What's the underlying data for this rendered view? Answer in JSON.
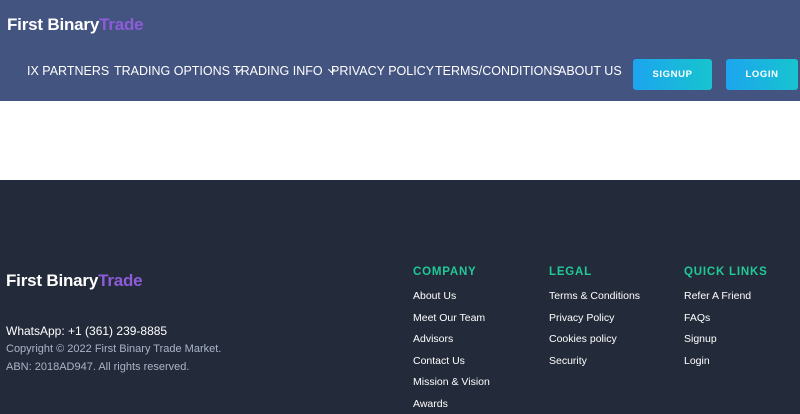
{
  "brand": {
    "part1": "First Binary",
    "part2": "Trade"
  },
  "nav": {
    "items": [
      {
        "label": "IX PARTNERS",
        "dropdown": false
      },
      {
        "label": "TRADING OPTIONS",
        "dropdown": true
      },
      {
        "label": "TRADING INFO",
        "dropdown": true
      },
      {
        "label": "PRIVACY POLICY",
        "dropdown": false
      },
      {
        "label": "TERMS/CONDITIONS",
        "dropdown": false
      },
      {
        "label": "ABOUT US",
        "dropdown": false
      }
    ],
    "signup_label": "SIGNUP",
    "login_label": "LOGIN"
  },
  "footer": {
    "whatsapp": "WhatsApp: +1 (361) 239-8885",
    "copyright": "Copyright © 2022 First Binary Trade Market.",
    "abn": "ABN: 2018AD947. All rights reserved.",
    "columns": [
      {
        "heading": "COMPANY",
        "links": [
          "About Us",
          "Meet Our Team",
          "Advisors",
          "Contact Us",
          "Mission & Vision",
          "Awards"
        ]
      },
      {
        "heading": "LEGAL",
        "links": [
          "Terms & Conditions",
          "Privacy Policy",
          "Cookies policy",
          "Security"
        ]
      },
      {
        "heading": "QUICK LINKS",
        "links": [
          "Refer A Friend",
          "FAQs",
          "Signup",
          "Login"
        ]
      }
    ]
  },
  "colors": {
    "header_bg": "#445481",
    "footer_bg": "#232a39",
    "brand_accent": "#8e5cd9",
    "footer_heading": "#20c997",
    "button_gradient_start": "#1ca5ee",
    "button_gradient_end": "#17c4cf"
  }
}
